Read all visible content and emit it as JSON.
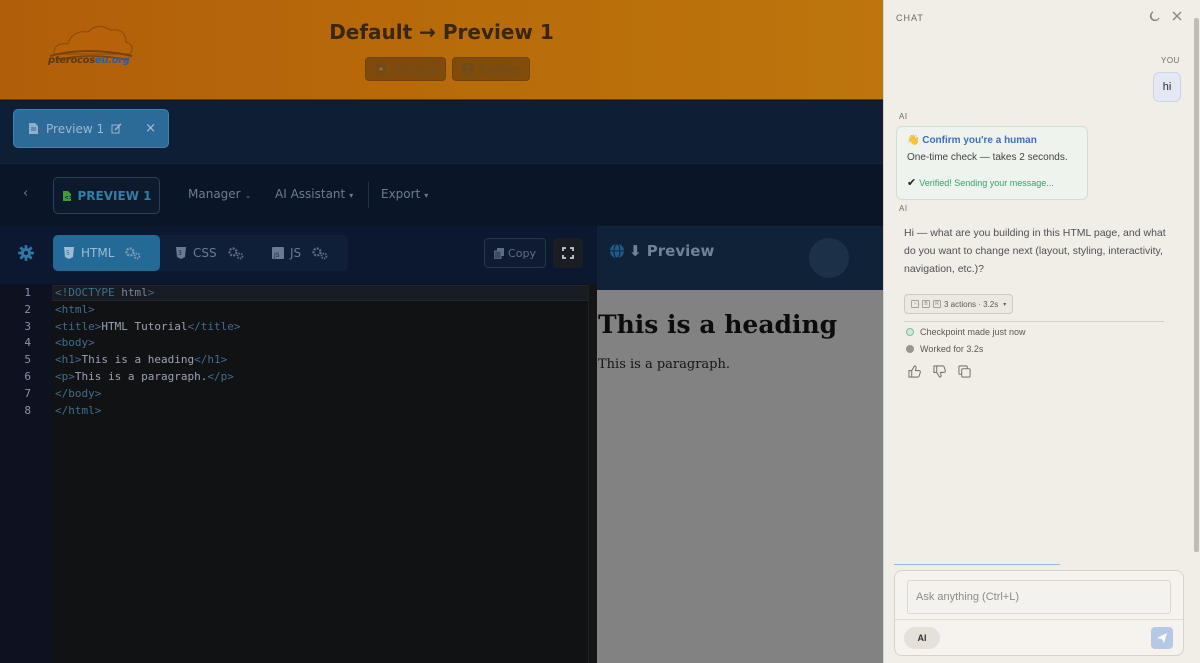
{
  "header": {
    "logo_text_main": "pterocos",
    "logo_text_accent": "eu.org",
    "title": "Default → Preview 1",
    "buttons": [
      {
        "label": "Settings",
        "icon": "gear-icon"
      },
      {
        "label": "Explore",
        "icon": "globe-icon"
      }
    ]
  },
  "file_tabs": [
    {
      "label": "Preview 1",
      "icon": "file-icon",
      "edit_icon": "edit-icon",
      "close": "×"
    }
  ],
  "menu": {
    "back": "‹",
    "preview_label": "PREVIEW 1",
    "items": [
      {
        "label": "Manager",
        "caret": "⌄"
      },
      {
        "label": "AI Assistant",
        "caret": "▾"
      },
      {
        "label": "Export",
        "caret": "▾"
      }
    ]
  },
  "editor": {
    "tabs": [
      {
        "label": "HTML",
        "icon": "html5-icon",
        "active": true
      },
      {
        "label": "CSS",
        "icon": "css3-icon",
        "active": false
      },
      {
        "label": "JS",
        "icon": "js-icon",
        "active": false
      }
    ],
    "copy_label": "Copy",
    "lines": [
      {
        "n": "1",
        "text": "<!DOCTYPE html>"
      },
      {
        "n": "2",
        "text": "<html>"
      },
      {
        "n": "3",
        "text": "<title>HTML Tutorial</title>"
      },
      {
        "n": "4",
        "text": "<body>"
      },
      {
        "n": "5",
        "text": "<h1>This is a heading</h1>"
      },
      {
        "n": "6",
        "text": "<p>This is a paragraph.</p>"
      },
      {
        "n": "7",
        "text": "</body>"
      },
      {
        "n": "8",
        "text": "</html>"
      }
    ]
  },
  "preview": {
    "title": "⬇ Preview",
    "heading": "This is a heading",
    "paragraph": "This is a paragraph."
  },
  "chat": {
    "title": "CHAT",
    "you_label": "YOU",
    "user_message": "hi",
    "ai_label": "AI",
    "captcha": {
      "title": "👋 Confirm you're a human",
      "subtitle": "One-time check — takes 2 seconds.",
      "verified": "Verified! Sending your message...",
      "check": "✔"
    },
    "ai_message": "Hi — what are you building in this HTML page, and what do you want to change next (layout, styling, interactivity, navigation, etc.)?",
    "actions_pill": "3 actions · 3.2s",
    "checkpoint": "Checkpoint made just now",
    "worked": "Worked for 3.2s",
    "input_placeholder": "Ask anything (Ctrl+L)",
    "ai_chip": "AI"
  },
  "colors": {
    "header_orange": "#b86a0a",
    "active_tab_blue": "#246a96",
    "chat_bg": "#f1eee8",
    "link_blue": "#3b6fc4",
    "success_green": "#35a36b"
  }
}
